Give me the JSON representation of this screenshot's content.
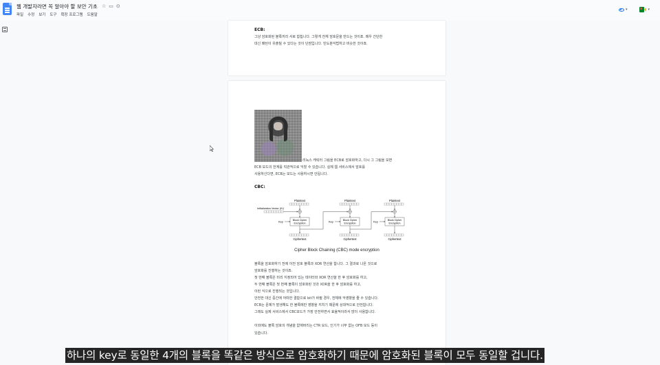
{
  "window": {
    "doc_title": "웹 개발자라면 꼭 알아야 할 보안 기초",
    "title_icons": [
      "star-icon",
      "folder-icon",
      "cloud-status-icon"
    ],
    "title_icon_glyphs": [
      "☆",
      "▭",
      "⊙"
    ],
    "menu": [
      "파일",
      "수정",
      "보기",
      "도구",
      "확장 프로그램",
      "도움말"
    ],
    "caret_glyph": "▾",
    "accent_color": "#1a73e8"
  },
  "page1": {
    "heading": "ECB:",
    "lines": [
      "그냥 암호화된 블록끼리 서로 합칩니다. 그렇게 전체 암호문을 만드는 것이죠. 매우 간단한",
      "대신 패턴이 유출될 수 있다는 것이 단점입니다. 빈도분석법하고 비슷한 것이죠."
    ]
  },
  "page2": {
    "image_caption_lines": [
      "리눅스 캐릭터 그림을 ECB로 암호화하고, 다시 그 그림을 보면",
      "ECB 모드의 한계를 직관적으로 익힐 수 있습니다. 실제 웹 서비스에서 암호를",
      "사용하신다면, ECB는 모드는 사용하시면 안됩니다."
    ],
    "cbc_heading": "CBC:",
    "diagram": {
      "plaintext_label": "Plaintext",
      "ciphertext_label": "Ciphertext",
      "iv_label": "Initialization Vector (IV)",
      "key_label": "Key",
      "block_label_line1": "Block Cipher",
      "block_label_line2": "Encryption",
      "caption": "Cipher Block Chaining (CBC) mode encryption"
    },
    "body_lines": [
      "블록을 암호화하기 전에 이전 암호 블록과 XOR 연산을 합니다. 그 결과로 나온 것으로",
      "암호화를 진행하는 것이죠.",
      "첫 번째 블록은 미리 지정되어 있는 데이터와 XOR 연산을 한 후 암호화를 하고,",
      "두 번째 블록은 첫 번째 블록이 암호화된 것과 XOR을 한 후 암호화를 하고,",
      "이런 식으로 진행되는 것입니다.",
      "안전한 대신 중간에 어떠한 결함으로 bit가 바뀔 경우, 전체에 악영향을 줄 수 있습니다.",
      "ECB는 문제가 발생해도 한 블록에만 영향을 끼치기 때문에 상대적으로 안전합니다.",
      "그래도 실제 서비스에서 CBC모드가 가장 안전하면서 효율적이라서 많이 사용합니다."
    ],
    "extra_line1": "이외에도 블록 암호의 개념을 없애버리는 CTR 모드, 인기가 너무 없는 OFB 모드 등이",
    "extra_line2": "있습니다."
  },
  "subtitle": "하나의 key로 동일한 4개의 블록을 똑같은 방식으로 암호화하기 때문에 암호화된 블록이 모두 동일할 겁니다."
}
